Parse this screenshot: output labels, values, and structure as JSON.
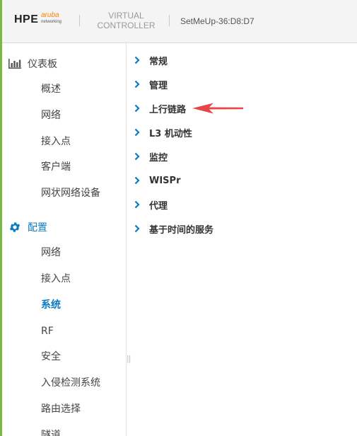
{
  "header": {
    "logo_main": "HPE",
    "logo_brand": "aruba",
    "logo_sub": "networking",
    "product_line1": "VIRTUAL",
    "product_line2": "CONTROLLER",
    "device_name": "SetMeUp-36:D8:D7"
  },
  "sidebar": {
    "dashboard": {
      "label": "仪表板",
      "icon": "bar-chart-icon",
      "items": [
        "概述",
        "网络",
        "接入点",
        "客户端",
        "网状网络设备"
      ]
    },
    "config": {
      "label": "配置",
      "icon": "gear-icon",
      "items": [
        "网络",
        "接入点",
        "系统",
        "RF",
        "安全",
        "入侵检测系统",
        "路由选择",
        "隧道"
      ],
      "selected": "系统"
    }
  },
  "splitter": "||",
  "content": {
    "sections": [
      "常规",
      "管理",
      "上行链路",
      "L3 机动性",
      "监控",
      "WISPr",
      "代理",
      "基于时间的服务"
    ],
    "highlighted": "上行链路"
  },
  "colors": {
    "accent": "#0a7bc1",
    "left_bar": "#77bb44",
    "annotation_arrow": "#e8454a",
    "brand_orange": "#ff8300"
  }
}
